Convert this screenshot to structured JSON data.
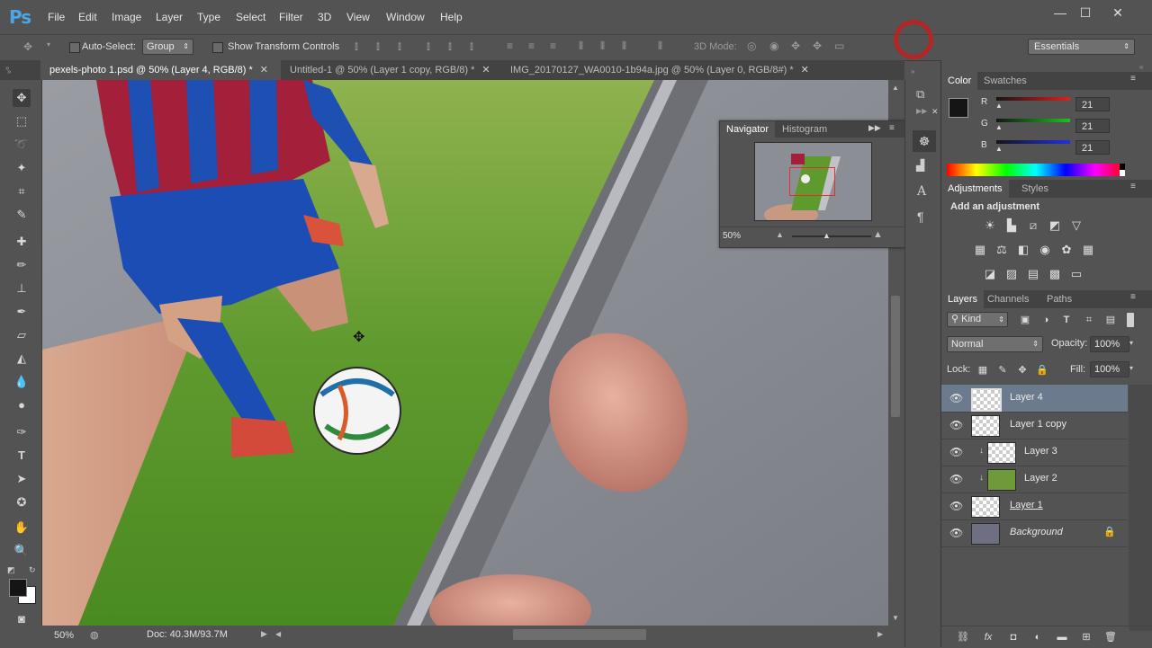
{
  "app": {
    "logo": "Ps"
  },
  "menu": [
    "File",
    "Edit",
    "Image",
    "Layer",
    "Type",
    "Select",
    "Filter",
    "3D",
    "View",
    "Window",
    "Help"
  ],
  "window_controls": {
    "minimize": "—",
    "maximize": "☐",
    "close": "✕"
  },
  "options": {
    "auto_select_label": "Auto-Select:",
    "auto_select_value": "Group",
    "show_transform_label": "Show Transform Controls",
    "mode_3d_label": "3D Mode:",
    "workspace": "Essentials"
  },
  "tabs": [
    {
      "label": "pexels-photo 1.psd @ 50% (Layer 4, RGB/8) *",
      "active": true
    },
    {
      "label": "Untitled-1 @ 50% (Layer 1 copy, RGB/8) *",
      "active": false
    },
    {
      "label": "IMG_20170127_WA0010-1b94a.jpg @ 50% (Layer 0, RGB/8#) *",
      "active": false
    }
  ],
  "navigator": {
    "tab1": "Navigator",
    "tab2": "Histogram",
    "zoom": "50%"
  },
  "color_panel": {
    "tab1": "Color",
    "tab2": "Swatches",
    "channels": [
      {
        "label": "R",
        "value": "21",
        "color": "#d0312d"
      },
      {
        "label": "G",
        "value": "21",
        "color": "#2ea043"
      },
      {
        "label": "B",
        "value": "21",
        "color": "#2a49d6"
      }
    ]
  },
  "adjustments": {
    "tab1": "Adjustments",
    "tab2": "Styles",
    "heading": "Add an adjustment"
  },
  "layers_panel": {
    "tab1": "Layers",
    "tab2": "Channels",
    "tab3": "Paths",
    "filter": "Kind",
    "blend_mode": "Normal",
    "opacity_label": "Opacity:",
    "opacity": "100%",
    "lock_label": "Lock:",
    "fill_label": "Fill:",
    "fill": "100%",
    "layers": [
      {
        "name": "Layer 4",
        "selected": true,
        "clipped": false
      },
      {
        "name": "Layer 1 copy",
        "selected": false,
        "clipped": false
      },
      {
        "name": "Layer 3",
        "selected": false,
        "clipped": true
      },
      {
        "name": "Layer 2",
        "selected": false,
        "clipped": true
      },
      {
        "name": "Layer 1",
        "selected": false,
        "clipped": false
      },
      {
        "name": "Background",
        "selected": false,
        "clipped": false
      }
    ]
  },
  "status": {
    "zoom": "50%",
    "doc": "Doc: 40.3M/93.7M"
  },
  "colors": {
    "accent": "#4aa6e6",
    "panel": "#535353",
    "selected_layer": "#6b7b8d"
  }
}
